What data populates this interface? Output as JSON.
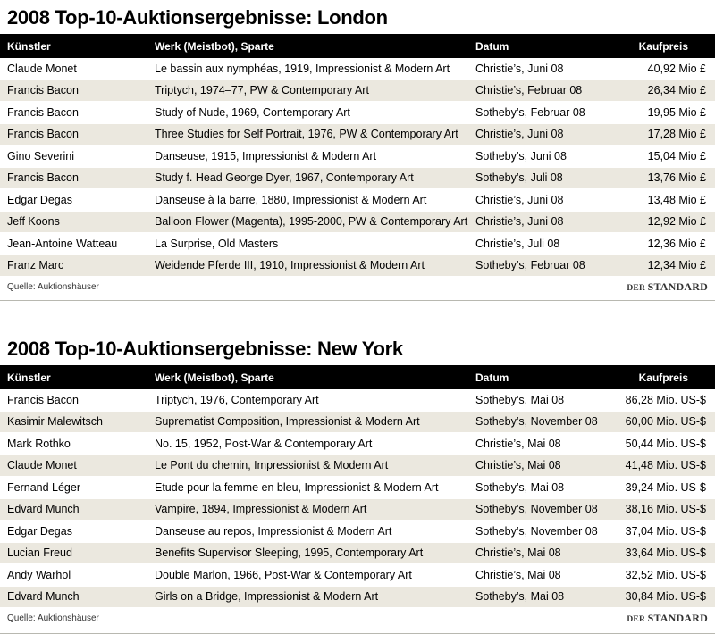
{
  "columns": {
    "artist": "Künstler",
    "work": "Werk (Meistbot), Sparte",
    "date": "Datum",
    "price": "Kaufpreis"
  },
  "london": {
    "title": "2008 Top-10-Auktionsergebnisse: London",
    "rows": [
      {
        "artist": "Claude Monet",
        "work": "Le bassin aux nymphéas, 1919, Impressionist & Modern Art",
        "date": "Christie’s, Juni 08",
        "price": "40,92 Mio £"
      },
      {
        "artist": "Francis Bacon",
        "work": "Triptych, 1974–77, PW & Contemporary Art",
        "date": "Christie’s, Februar 08",
        "price": "26,34 Mio £"
      },
      {
        "artist": "Francis Bacon",
        "work": "Study of Nude, 1969, Contemporary Art",
        "date": "Sotheby’s, Februar 08",
        "price": "19,95 Mio £"
      },
      {
        "artist": "Francis Bacon",
        "work": "Three Studies for Self Portrait, 1976, PW & Contemporary Art",
        "date": "Christie’s, Juni 08",
        "price": "17,28 Mio £"
      },
      {
        "artist": "Gino Severini",
        "work": "Danseuse, 1915, Impressionist & Modern Art",
        "date": "Sotheby’s, Juni 08",
        "price": "15,04 Mio £"
      },
      {
        "artist": "Francis Bacon",
        "work": "Study f. Head George Dyer, 1967, Contemporary Art",
        "date": "Sotheby’s, Juli 08",
        "price": "13,76 Mio £"
      },
      {
        "artist": "Edgar Degas",
        "work": "Danseuse à la barre, 1880, Impressionist & Modern Art",
        "date": "Christie’s, Juni 08",
        "price": "13,48 Mio £"
      },
      {
        "artist": "Jeff Koons",
        "work": "Balloon Flower (Magenta), 1995-2000, PW & Contemporary Art",
        "date": "Christie’s, Juni 08",
        "price": "12,92 Mio £"
      },
      {
        "artist": "Jean-Antoine Watteau",
        "work": "La Surprise, Old Masters",
        "date": "Christie’s, Juli 08",
        "price": "12,36 Mio £"
      },
      {
        "artist": "Franz Marc",
        "work": "Weidende Pferde III, 1910, Impressionist & Modern Art",
        "date": "Sotheby’s, Februar 08",
        "price": "12,34 Mio £"
      }
    ],
    "source": "Quelle: Auktionshäuser",
    "brand_a": "DER ",
    "brand_b": "STANDARD"
  },
  "newyork": {
    "title": "2008 Top-10-Auktionsergebnisse: New York",
    "rows": [
      {
        "artist": "Francis Bacon",
        "work": "Triptych, 1976, Contemporary Art",
        "date": "Sotheby’s, Mai 08",
        "price": "86,28 Mio. US-$"
      },
      {
        "artist": "Kasimir Malewitsch",
        "work": "Suprematist Composition, Impressionist & Modern Art",
        "date": "Sotheby’s, November 08",
        "price": "60,00 Mio. US-$"
      },
      {
        "artist": "Mark Rothko",
        "work": "No. 15, 1952, Post-War & Contemporary Art",
        "date": "Christie’s, Mai 08",
        "price": "50,44 Mio. US-$"
      },
      {
        "artist": "Claude Monet",
        "work": "Le Pont du chemin, Impressionist & Modern Art",
        "date": "Christie’s, Mai 08",
        "price": "41,48 Mio. US-$"
      },
      {
        "artist": "Fernand Léger",
        "work": "Etude pour la femme en bleu, Impressionist & Modern Art",
        "date": "Sotheby’s, Mai 08",
        "price": "39,24 Mio. US-$"
      },
      {
        "artist": "Edvard Munch",
        "work": "Vampire, 1894, Impressionist & Modern Art",
        "date": "Sotheby’s, November 08",
        "price": "38,16 Mio. US-$"
      },
      {
        "artist": "Edgar Degas",
        "work": "Danseuse au repos, Impressionist & Modern Art",
        "date": "Sotheby’s, November 08",
        "price": "37,04 Mio. US-$"
      },
      {
        "artist": "Lucian Freud",
        "work": "Benefits Supervisor Sleeping, 1995, Contemporary Art",
        "date": "Christie’s, Mai 08",
        "price": "33,64 Mio. US-$"
      },
      {
        "artist": "Andy Warhol",
        "work": "Double Marlon, 1966, Post-War & Contemporary Art",
        "date": "Christie’s, Mai 08",
        "price": "32,52 Mio. US-$"
      },
      {
        "artist": "Edvard Munch",
        "work": "Girls on a Bridge, Impressionist & Modern Art",
        "date": "Sotheby’s, Mai 08",
        "price": "30,84 Mio. US-$"
      }
    ],
    "source": "Quelle: Auktionshäuser",
    "brand_a": "DER ",
    "brand_b": "STANDARD"
  },
  "colors": {
    "header_bg": "#000000",
    "row_alt": "#ebe8df"
  }
}
